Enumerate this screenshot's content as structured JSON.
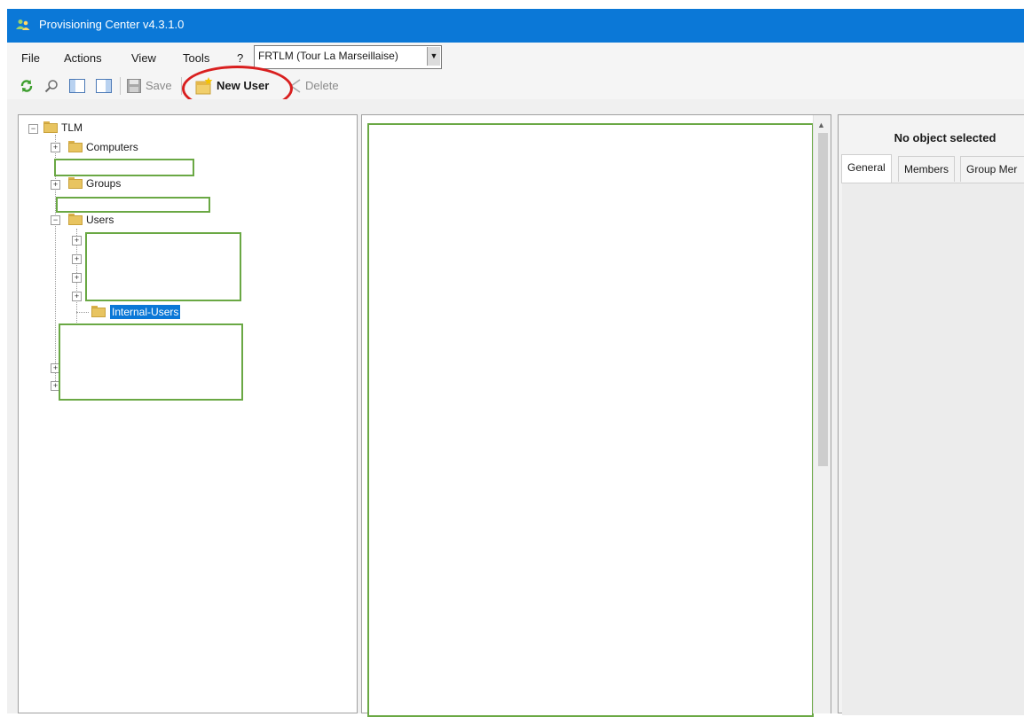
{
  "window": {
    "title": "Provisioning Center v4.3.1.0",
    "titlebar_color": "#0b78d7"
  },
  "menu": {
    "items": [
      "File",
      "Actions",
      "View",
      "Tools",
      "?"
    ],
    "site_selector": {
      "value": "FRTLM (Tour La Marseillaise)"
    }
  },
  "toolbar": {
    "refresh_icon": "refresh-icon",
    "search_icon": "search-icon",
    "save_label": "Save",
    "new_user_label": "New User",
    "delete_label": "Delete",
    "highlight_color": "#d91f1f"
  },
  "tree": {
    "root": "TLM",
    "nodes": {
      "computers": "Computers",
      "groups": "Groups",
      "users": "Users",
      "internal_users": "Internal-Users"
    },
    "redaction_color": "#6aa844"
  },
  "details": {
    "header": "No object selected",
    "tabs": [
      "General",
      "Members",
      "Group Mer"
    ]
  }
}
